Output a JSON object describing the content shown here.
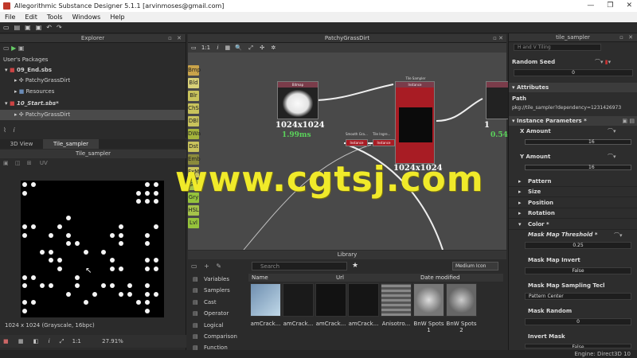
{
  "window": {
    "title": "Allegorithmic Substance Designer 5.1.1 [arvinmoses@gmail.com]",
    "controls": [
      "—",
      "❐",
      "✕"
    ]
  },
  "menu": [
    "File",
    "Edit",
    "Tools",
    "Windows",
    "Help"
  ],
  "explorer": {
    "title": "Explorer",
    "section": "User's Packages",
    "items": [
      {
        "label": "09_End.sbs"
      },
      {
        "label": "PatchyGrassDirt"
      },
      {
        "label": "Resources"
      },
      {
        "label": "10_Start.sbs*"
      },
      {
        "label": "PatchyGrassDirt"
      }
    ]
  },
  "view2d": {
    "tabs": [
      "3D View",
      "Tile_sampler"
    ],
    "title": "Tile_sampler",
    "channel": "UV",
    "info": "1024 x 1024 (Grayscale, 16bpc)",
    "zoom": "27.91%",
    "scale_label": "1:1"
  },
  "graph": {
    "title": "PatchyGrassDirt",
    "scale_label": "1:1",
    "sidebar": [
      {
        "label": "Bmp",
        "color": "#c9a34a"
      },
      {
        "label": "Bld",
        "color": "#d8d078"
      },
      {
        "label": "Blr",
        "color": "#c9c35c"
      },
      {
        "label": "ChS",
        "color": "#c9c35c"
      },
      {
        "label": "DBl",
        "color": "#c9c35c"
      },
      {
        "label": "DWa",
        "color": "#a5b43c"
      },
      {
        "label": "Dst",
        "color": "#c9c35c"
      },
      {
        "label": "Emb",
        "color": "#8a8a3c"
      },
      {
        "label": "FxM",
        "color": "#c9c35c"
      },
      {
        "label": "Gra",
        "color": "#a5c34a"
      },
      {
        "label": "Gry",
        "color": "#95c33c"
      },
      {
        "label": "HSL",
        "color": "#a5c34a"
      },
      {
        "label": "Lvl",
        "color": "#95c33c"
      }
    ],
    "nodes": {
      "bitmap": {
        "title": "Bitmap",
        "resolution": "1024x1024",
        "time": "1.99ms"
      },
      "tile": {
        "title": "Tile Sampler",
        "body_title": "Instance",
        "resolution": "1024x1024"
      },
      "right": {
        "resolution": "1",
        "time": "0.54"
      },
      "small1": {
        "title": "Smooth Gra...",
        "body": "Instance"
      },
      "small2": {
        "title": "Tile Ingre...",
        "body": "Instance"
      }
    },
    "watermark": "www.cgtsj.com"
  },
  "library": {
    "title": "Library",
    "search_placeholder": "Search",
    "icon_size": "Medium Icon",
    "columns": [
      "Name",
      "Url",
      "Date modified"
    ],
    "categories": [
      "Variables",
      "Samplers",
      "Cast",
      "Operator",
      "Logical",
      "Comparison",
      "Function"
    ],
    "thumbs": [
      {
        "label": "amCrack..."
      },
      {
        "label": "amCrack..."
      },
      {
        "label": "amCrack..."
      },
      {
        "label": "amCrack..."
      },
      {
        "label": "Anisotro..."
      },
      {
        "label": "BnW Spots\n1"
      },
      {
        "label": "BnW Spots\n2"
      }
    ]
  },
  "properties": {
    "title": "tile_sampler",
    "tiling_value": "H and V Tiling",
    "random_seed_label": "Random Seed",
    "random_seed": "0",
    "attributes": "Attributes",
    "path_label": "Path",
    "path": "pkg://tile_sampler?dependency=1231426973",
    "instance_params": "Instance Parameters *",
    "x_amount_label": "X Amount",
    "x_amount": "16",
    "y_amount_label": "Y Amount",
    "y_amount": "16",
    "sections": [
      "Pattern",
      "Size",
      "Position",
      "Rotation",
      "Color *"
    ],
    "mask_threshold_label": "Mask Map Threshold *",
    "mask_threshold": "0.25",
    "mask_invert_label": "Mask Map Invert",
    "mask_invert": "False",
    "mask_sampling_label": "Mask Map Sampling Tecl",
    "mask_sampling": "Pattern Center",
    "mask_random_label": "Mask Random",
    "mask_random": "0",
    "invert_mask_label": "Invert Mask",
    "invert_mask": "False"
  },
  "status": {
    "engine": "Engine: Direct3D 10"
  }
}
